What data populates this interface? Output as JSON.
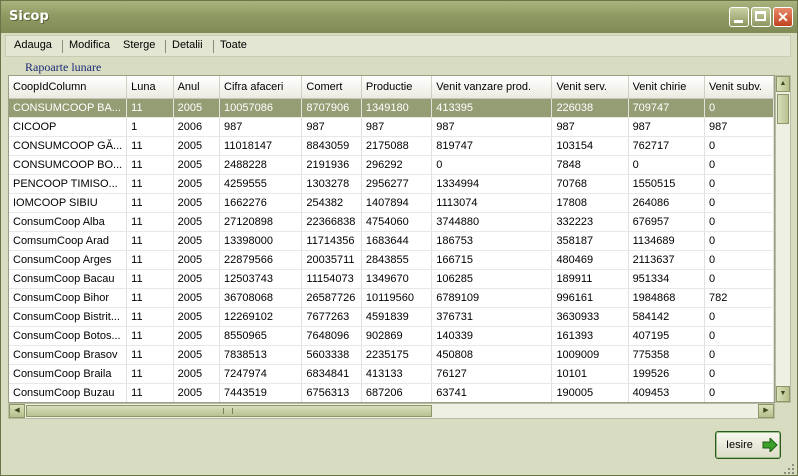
{
  "window": {
    "title": "Sicop"
  },
  "menu": [
    "Adauga",
    "Modifica",
    "Sterge",
    "Detalii",
    "Toate"
  ],
  "section_title": "Rapoarte lunare",
  "table": {
    "columns": [
      "CoopIdColumn",
      "Luna",
      "Anul",
      "Cifra afaceri",
      "Comert",
      "Productie",
      "Venit vanzare prod.",
      "Venit serv.",
      "Venit chirie",
      "Venit subv."
    ],
    "rows": [
      [
        "CONSUMCOOP BA...",
        "11",
        "2005",
        "10057086",
        "8707906",
        "1349180",
        "413395",
        "226038",
        "709747",
        "0"
      ],
      [
        "CICOOP",
        "1",
        "2006",
        "987",
        "987",
        "987",
        "987",
        "987",
        "987",
        "987"
      ],
      [
        "CONSUMCOOP GĂ...",
        "11",
        "2005",
        "11018147",
        "8843059",
        "2175088",
        "819747",
        "103154",
        "762717",
        "0"
      ],
      [
        "CONSUMCOOP BO...",
        "11",
        "2005",
        "2488228",
        "2191936",
        "296292",
        "0",
        "7848",
        "0",
        "0"
      ],
      [
        "PENCOOP TIMISO...",
        "11",
        "2005",
        "4259555",
        "1303278",
        "2956277",
        "1334994",
        "70768",
        "1550515",
        "0"
      ],
      [
        "IOMCOOP SIBIU",
        "11",
        "2005",
        "1662276",
        "254382",
        "1407894",
        "1113074",
        "17808",
        "264086",
        "0"
      ],
      [
        "ConsumCoop Alba",
        "11",
        "2005",
        "27120898",
        "22366838",
        "4754060",
        "3744880",
        "332223",
        "676957",
        "0"
      ],
      [
        "ComsumCoop Arad",
        "11",
        "2005",
        "13398000",
        "11714356",
        "1683644",
        "186753",
        "358187",
        "1134689",
        "0"
      ],
      [
        "ConsumCoop Arges",
        "11",
        "2005",
        "22879566",
        "20035711",
        "2843855",
        "166715",
        "480469",
        "2113637",
        "0"
      ],
      [
        "ConsumCoop Bacau",
        "11",
        "2005",
        "12503743",
        "11154073",
        "1349670",
        "106285",
        "189911",
        "951334",
        "0"
      ],
      [
        "ConsumCoop Bihor",
        "11",
        "2005",
        "36708068",
        "26587726",
        "10119560",
        "6789109",
        "996161",
        "1984868",
        "782"
      ],
      [
        "ConsumCoop Bistrit...",
        "11",
        "2005",
        "12269102",
        "7677263",
        "4591839",
        "376731",
        "3630933",
        "584142",
        "0"
      ],
      [
        "ConsumCoop Botos...",
        "11",
        "2005",
        "8550965",
        "7648096",
        "902869",
        "140339",
        "161393",
        "407195",
        "0"
      ],
      [
        "ConsumCoop Brasov",
        "11",
        "2005",
        "7838513",
        "5603338",
        "2235175",
        "450808",
        "1009009",
        "775358",
        "0"
      ],
      [
        "ConsumCoop Braila",
        "11",
        "2005",
        "7247974",
        "6834841",
        "413133",
        "76127",
        "10101",
        "199526",
        "0"
      ],
      [
        "ConsumCoop Buzau",
        "11",
        "2005",
        "7443519",
        "6756313",
        "687206",
        "63741",
        "190005",
        "409453",
        "0"
      ]
    ]
  },
  "exit_button": {
    "label": "Iesire"
  },
  "colors": {
    "selected_row": "#959d74",
    "title_bar": "#8f9a63",
    "section_title": "#1a2a7a"
  }
}
